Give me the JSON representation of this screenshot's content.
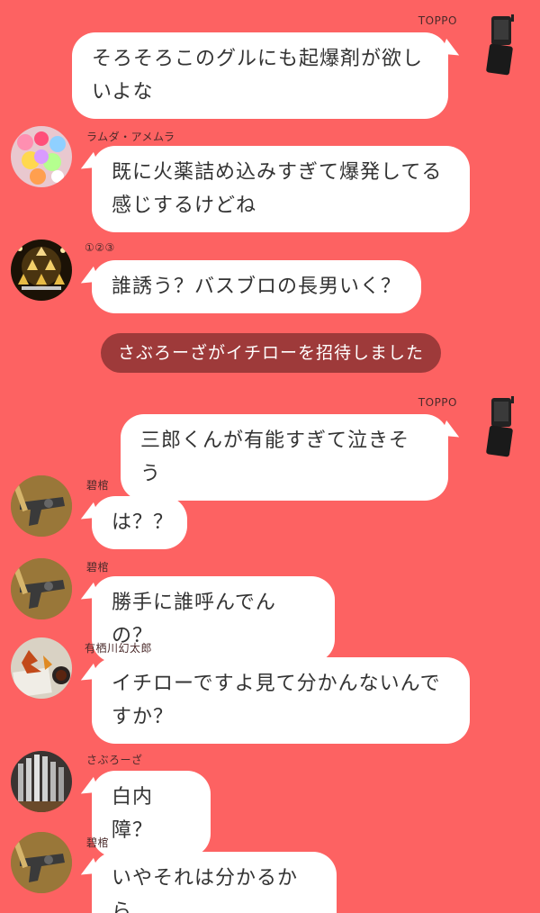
{
  "messages": [
    {
      "sender": "TOPPO",
      "text": "そろそろこのグルにも起爆剤が欲し\nいよな",
      "side": "right",
      "avatar_icon": "flip-phone-icon"
    },
    {
      "sender": "ラムダ・アメムラ",
      "text": "既に火薬詰め込みすぎて爆発してる\n感じするけどね",
      "side": "left",
      "avatar_icon": "candy-avatar-icon"
    },
    {
      "sender": "①②③",
      "text": "誰誘う？バスブロの長男いく？",
      "side": "left",
      "avatar_icon": "champagne-tower-avatar-icon"
    },
    {
      "sender": "TOPPO",
      "text": "三郎くんが有能すぎて泣きそう",
      "side": "right",
      "avatar_icon": "flip-phone-icon"
    },
    {
      "sender": "碧棺",
      "text": "は？？",
      "side": "left",
      "avatar_icon": "gun-avatar-icon"
    },
    {
      "sender": "碧棺",
      "text": "勝手に誰呼んでんの？",
      "side": "left",
      "avatar_icon": "gun-avatar-icon"
    },
    {
      "sender": "有栖川幻太郎",
      "text": "イチローですよ見て分かんないんで\nすか？",
      "side": "left",
      "avatar_icon": "autumn-leaves-avatar-icon"
    },
    {
      "sender": "さぶろーざ",
      "text": "白内障？",
      "side": "left",
      "avatar_icon": "pipe-organ-avatar-icon"
    },
    {
      "sender": "碧棺",
      "text": "いやそれは分かるから",
      "side": "left",
      "avatar_icon": "gun-avatar-icon"
    }
  ],
  "system_message": "さぶろーざがイチローを招待しました",
  "colors": {
    "background": "#fd6262",
    "bubble": "#ffffff",
    "system_pill": "#9e3a3a",
    "text": "#333333"
  }
}
